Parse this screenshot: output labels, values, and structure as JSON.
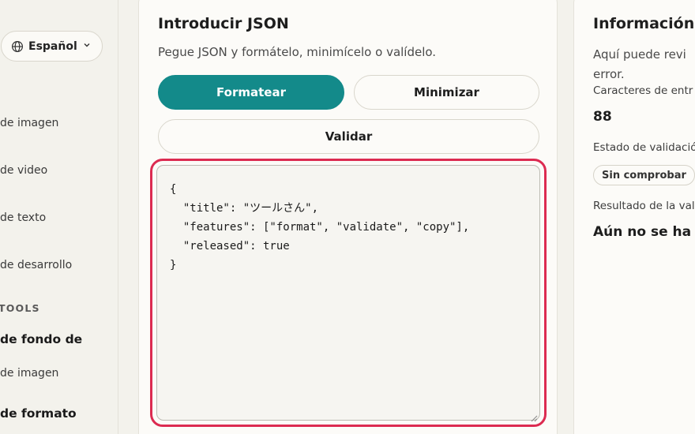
{
  "sidebar": {
    "language": {
      "label": "Español",
      "icon": "globe-icon"
    },
    "items": [
      {
        "label": "de imagen"
      },
      {
        "label": "de video"
      },
      {
        "label": "de texto"
      },
      {
        "label": "de desarrollo"
      }
    ],
    "section_title": "TOOLS",
    "tools": [
      {
        "label": "de fondo de",
        "bold": true
      },
      {
        "label": "de imagen",
        "bold": false
      },
      {
        "label": "de formato",
        "bold": true
      }
    ]
  },
  "input_card": {
    "title": "Introducir JSON",
    "subtitle": "Pegue JSON y formátelo, minimícelo o valídelo.",
    "buttons": {
      "format": "Formatear",
      "minify": "Minimizar",
      "validate": "Validar"
    },
    "json_text": "{\n  \"title\": \"ツールさん\",\n  \"features\": [\"format\", \"validate\", \"copy\"],\n  \"released\": true\n}",
    "colors": {
      "accent": "#138a8a",
      "focus_ring": "#dc2b51"
    }
  },
  "info_card": {
    "title": "Información d",
    "description_line1": "Aquí puede revi",
    "description_line2": "error.",
    "char_count_label": "Caracteres de entr",
    "char_count_value": "88",
    "validation_status_label": "Estado de validació",
    "validation_status_badge": "Sin comprobar",
    "validation_result_label": "Resultado de la val",
    "validation_result_value": "Aún no se ha ej"
  }
}
